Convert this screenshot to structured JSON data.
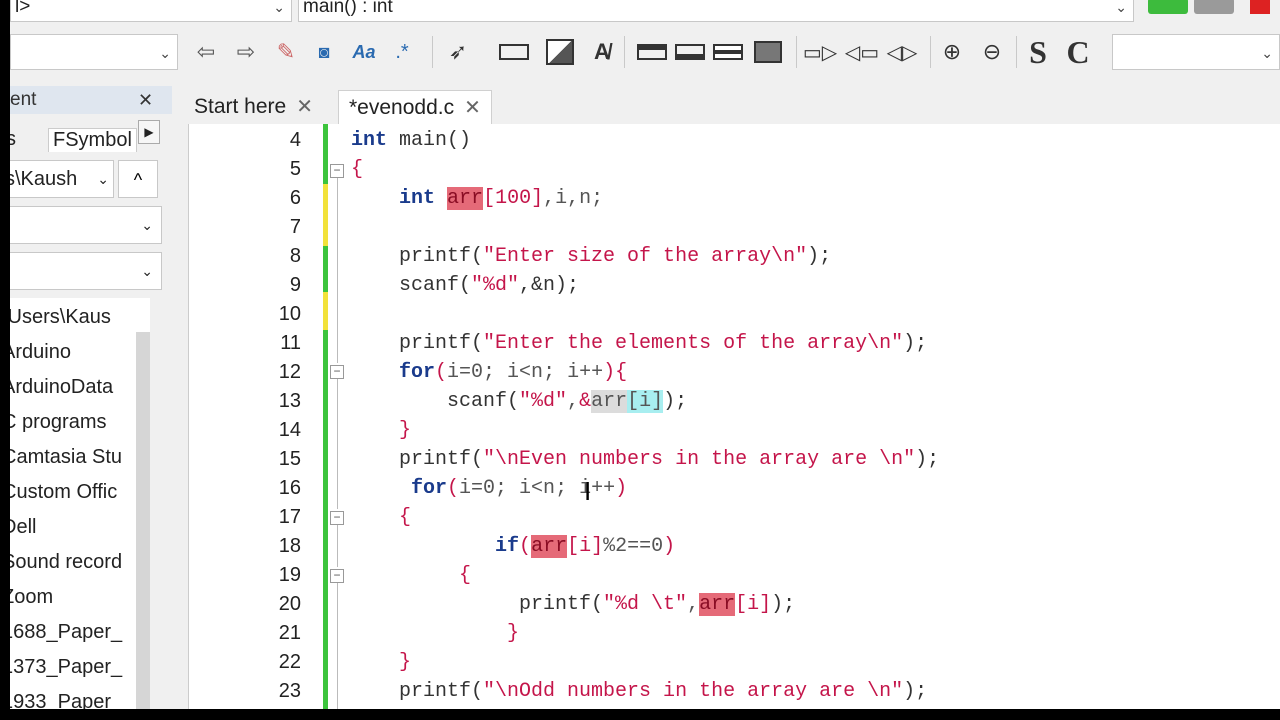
{
  "toolbar": {
    "scope_combo": "l>",
    "function_combo": "main() : int",
    "search_combo": "",
    "right_combo": "",
    "icons": [
      "back-arrow-icon",
      "forward-arrow-icon",
      "highlight-pen-icon",
      "find-binoculars-icon",
      "match-case-icon",
      "regex-icon",
      "select-arrow-icon",
      "rectangle-icon",
      "fill-icon",
      "clear-format-icon",
      "bar-1-icon",
      "bar-2-icon",
      "bar-3-icon",
      "bar-4-icon",
      "tag-right-icon",
      "tag-left-icon",
      "tag-both-icon",
      "zoom-in-icon",
      "zoom-out-icon",
      "s-icon",
      "c-icon"
    ],
    "s_label": "S",
    "c_label": "C"
  },
  "left_panel": {
    "header": "ent",
    "tab_files": "s",
    "tab_symbols": "FSymbol",
    "path_combo": "s\\Kaush",
    "up_button": "^",
    "tree": [
      "\\Users\\Kaus",
      "Arduino",
      "ArduinoData",
      "C programs",
      "Camtasia Stu",
      "Custom Offic",
      "Dell",
      "Sound record",
      "Zoom",
      "1688_Paper_",
      "1373_Paper_",
      "1933_Paper_"
    ]
  },
  "tabs": [
    {
      "label": "Start here",
      "close": "✕"
    },
    {
      "label": "*evenodd.c",
      "close": "✕"
    }
  ],
  "editor": {
    "line_numbers": [
      "4",
      "5",
      "6",
      "7",
      "8",
      "9",
      "10",
      "11",
      "12",
      "13",
      "14",
      "15",
      "16",
      "17",
      "18",
      "19",
      "20",
      "21",
      "22",
      "23"
    ],
    "colors": {
      "keyword": "#1a3b8c",
      "string": "#c4154a",
      "highlight": "#e56a78",
      "change_green": "#3cc43c",
      "change_yellow": "#f2e23a"
    }
  }
}
